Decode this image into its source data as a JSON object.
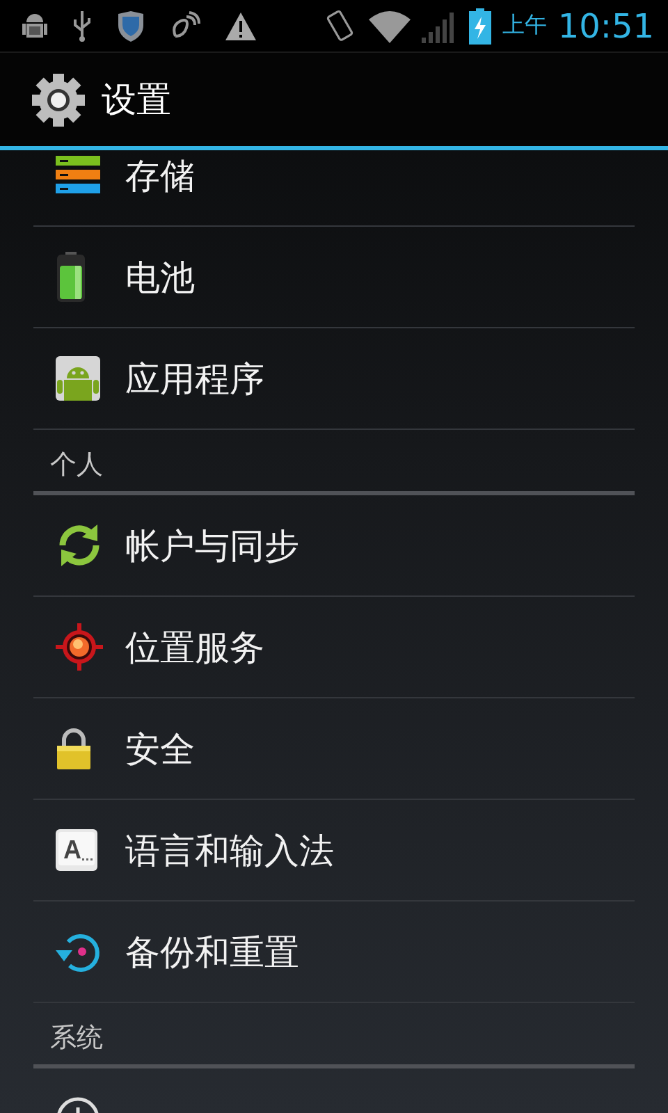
{
  "status_bar": {
    "time_period": "上午",
    "time": "10:51"
  },
  "action_bar": {
    "title": "设置"
  },
  "list": [
    {
      "kind": "item",
      "label": "存储"
    },
    {
      "kind": "item",
      "label": "电池"
    },
    {
      "kind": "item",
      "label": "应用程序"
    },
    {
      "kind": "header",
      "label": "个人"
    },
    {
      "kind": "item",
      "label": "帐户与同步"
    },
    {
      "kind": "item",
      "label": "位置服务"
    },
    {
      "kind": "item",
      "label": "安全"
    },
    {
      "kind": "item",
      "label": "语言和输入法"
    },
    {
      "kind": "item",
      "label": "备份和重置"
    },
    {
      "kind": "header",
      "label": "系统"
    }
  ]
}
